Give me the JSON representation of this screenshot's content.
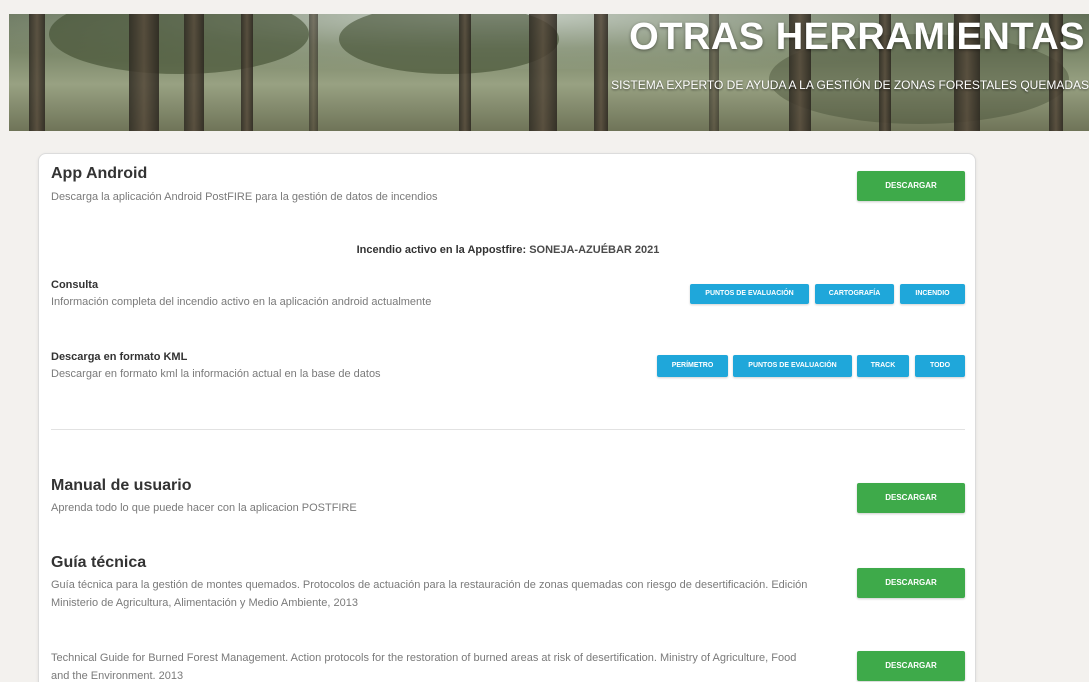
{
  "banner": {
    "title": "OTRAS HERRAMIENTAS",
    "subtitle": "SISTEMA EXPERTO DE AYUDA A LA GESTIÓN DE ZONAS FORESTALES QUEMADAS"
  },
  "app_android": {
    "title": "App Android",
    "description": "Descarga la aplicación Android PostFIRE para la gestión de datos de incendios",
    "button": "DESCARGAR"
  },
  "active_fire": {
    "label": "Incendio activo en la Appostfire:",
    "name": "SONEJA-AZUÉBAR 2021"
  },
  "consulta": {
    "title": "Consulta",
    "description": "Información completa del incendio activo en la aplicación android actualmente",
    "buttons": [
      "PUNTOS DE EVALUACIÓN",
      "CARTOGRAFÍA",
      "INCENDIO"
    ]
  },
  "kml": {
    "title": "Descarga en formato KML",
    "description": "Descargar en formato kml la información actual en la base de datos",
    "buttons": [
      "PERÍMETRO",
      "PUNTOS DE EVALUACIÓN",
      "TRACK",
      "TODO"
    ]
  },
  "manual": {
    "title": "Manual de usuario",
    "description": "Aprenda todo lo que puede hacer con la aplicacion POSTFIRE",
    "button": "DESCARGAR"
  },
  "guia": {
    "title": "Guía técnica",
    "description_line1": "Guía técnica para la gestión de montes quemados. Protocolos de actuación para la restauración de zonas quemadas con riesgo de desertificación. Edición",
    "description_line2": "Ministerio de Agricultura, Alimentación y Medio Ambiente, 2013",
    "button": "DESCARGAR"
  },
  "guide_en": {
    "description_line1": "Technical Guide for Burned Forest Management. Action protocols for the restoration of burned areas at risk of desertification. Ministry of Agriculture, Food",
    "description_line2": "and the Environment. 2013",
    "button": "DESCARGAR"
  },
  "colors": {
    "green_button": "#3eaa4a",
    "cyan_button": "#1fa7da",
    "page_background": "#f3f1ee"
  }
}
